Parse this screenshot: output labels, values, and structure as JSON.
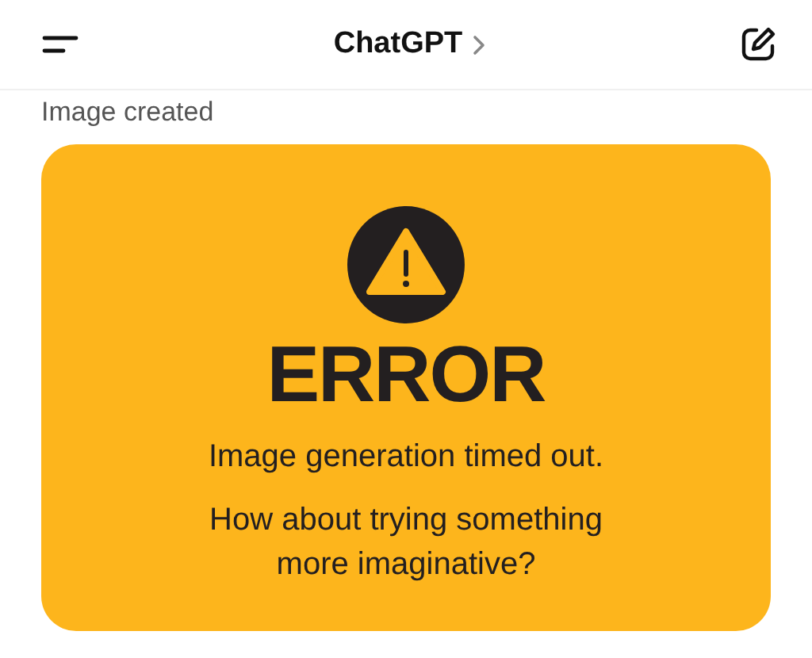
{
  "header": {
    "title": "ChatGPT"
  },
  "status": "Image created",
  "error_image": {
    "heading": "ERROR",
    "message": "Image generation timed out.",
    "suggestion": "How about trying something\nmore imaginative?"
  }
}
